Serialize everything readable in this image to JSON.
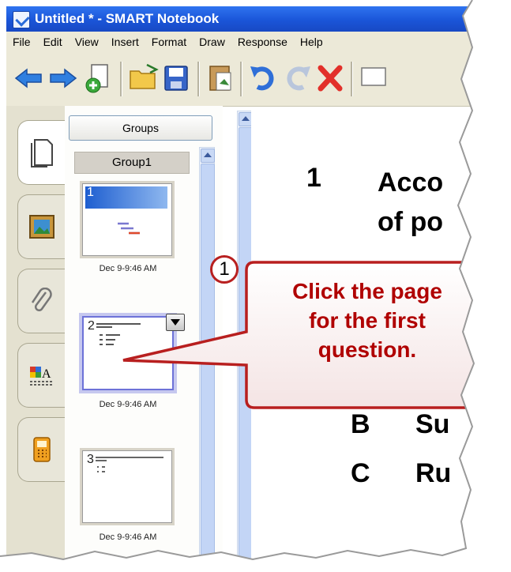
{
  "window": {
    "title": "Untitled * - SMART Notebook"
  },
  "menu": [
    "File",
    "Edit",
    "View",
    "Insert",
    "Format",
    "Draw",
    "Response",
    "Help"
  ],
  "toolbar": {
    "buttons": [
      "back-icon",
      "forward-icon",
      "add-page-icon",
      "open-icon",
      "save-icon",
      "paste-icon",
      "undo-icon",
      "redo-icon",
      "delete-icon",
      "screen-icon"
    ]
  },
  "side_tabs": [
    "page-sorter-icon",
    "gallery-icon",
    "attachments-icon",
    "properties-icon",
    "response-icon"
  ],
  "sorter": {
    "groups_label": "Groups",
    "group_name": "Group1",
    "pages": [
      {
        "number": "1",
        "date": "Dec 9-9:46 AM"
      },
      {
        "number": "2",
        "date": "Dec 9-9:46 AM"
      },
      {
        "number": "3",
        "date": "Dec 9-9:46 AM"
      }
    ]
  },
  "canvas": {
    "question_number": "1",
    "question_lines": [
      "Acco",
      "of po"
    ],
    "answers": [
      {
        "letter": "B",
        "text": "Su"
      },
      {
        "letter": "C",
        "text": "Ru"
      }
    ]
  },
  "callout": {
    "step": "1",
    "lines": [
      "Click the page",
      "for the first",
      "question."
    ]
  },
  "colors": {
    "titlebar": "#1a55d8",
    "callout_text": "#b00000",
    "selected_thumb": "#6d72d8"
  }
}
